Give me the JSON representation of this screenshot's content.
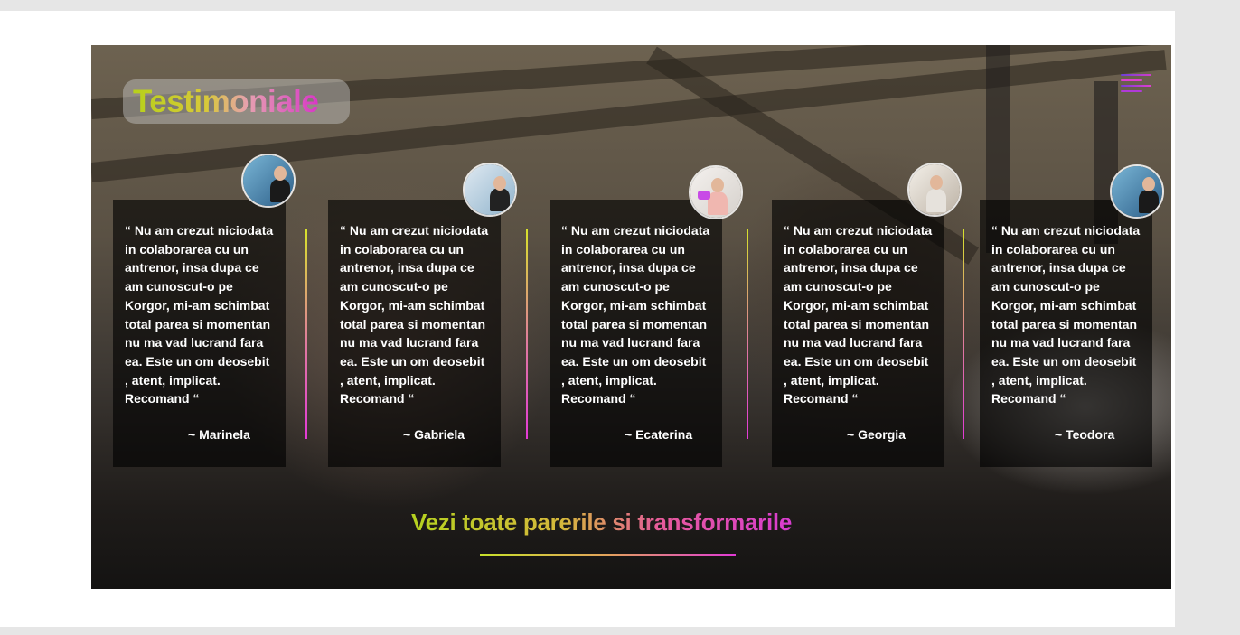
{
  "page": {
    "title": "Testimoniale",
    "cta_label": "Vezi toate parerile si transformarile"
  },
  "menu": {
    "icon": "hamburger-menu-icon"
  },
  "testimonials": [
    {
      "quote": "“ Nu am crezut niciodata\nin colaborarea cu un\nantrenor, insa dupa ce\nam cunoscut-o pe\n Korgor, mi-am schimbat\ntotal parea si momentan\nnu ma vad lucrand fara\nea. Este un om deosebit\n, atent, implicat.\nRecomand “",
      "author": "~ Marinela"
    },
    {
      "quote": "“ Nu am crezut niciodata\nin colaborarea cu un\nantrenor, insa dupa ce\nam cunoscut-o pe\n Korgor, mi-am schimbat\ntotal parea si momentan\nnu ma vad lucrand fara\nea. Este un om deosebit\n, atent, implicat.\nRecomand “",
      "author": "~ Gabriela"
    },
    {
      "quote": "“ Nu am crezut niciodata\nin colaborarea cu un\nantrenor, insa dupa ce\nam cunoscut-o pe\n Korgor, mi-am schimbat\ntotal parea si momentan\nnu ma vad lucrand fara\nea. Este un om deosebit\n, atent, implicat.\nRecomand “",
      "author": "~ Ecaterina"
    },
    {
      "quote": "“ Nu am crezut niciodata\nin colaborarea cu un\nantrenor, insa dupa ce\nam cunoscut-o pe\n Korgor, mi-am schimbat\ntotal parea si momentan\nnu ma vad lucrand fara\nea. Este un om deosebit\n, atent, implicat.\nRecomand “",
      "author": "~ Georgia"
    },
    {
      "quote": "“ Nu am crezut niciodata\nin colaborarea cu un\nantrenor, insa dupa ce\nam cunoscut-o pe\n Korgor, mi-am schimbat\ntotal parea si momentan\nnu ma vad lucrand fara\nea. Este un om deosebit\n, atent, implicat.\nRecomand “",
      "author": "~ Teodora"
    }
  ],
  "colors": {
    "gradient_start": "#b7d11a",
    "gradient_end": "#d838c6",
    "card_background": "rgba(0,0,0,0.62)",
    "text": "#ffffff"
  }
}
